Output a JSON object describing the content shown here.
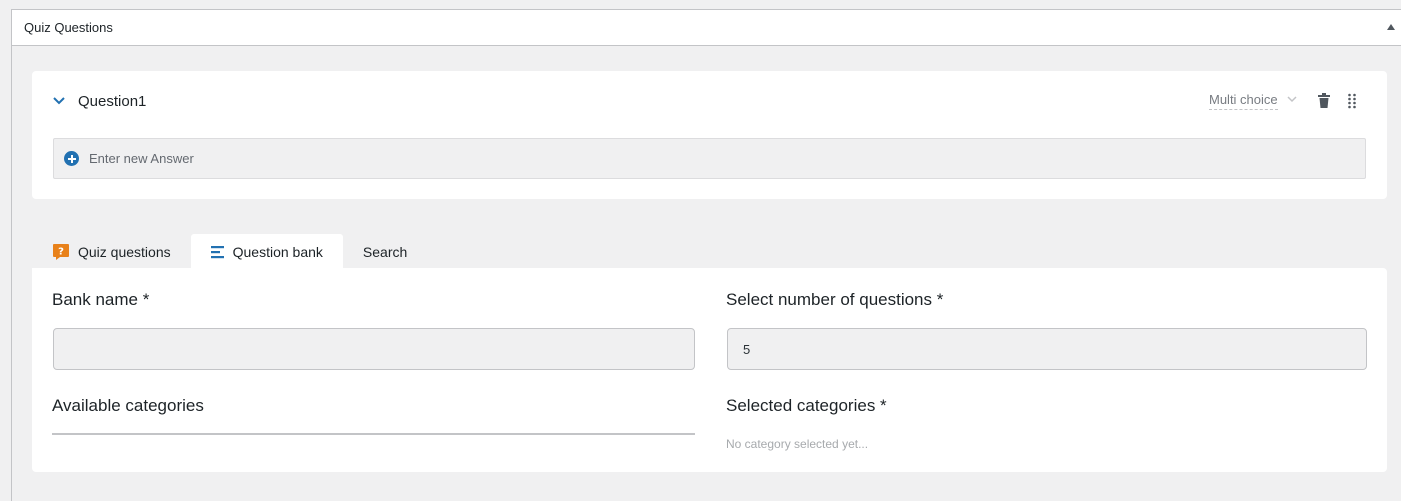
{
  "panel": {
    "title": "Quiz Questions"
  },
  "question": {
    "title": "Question1",
    "type": "Multi choice",
    "answer_placeholder": "Enter new Answer"
  },
  "tabs": [
    {
      "label": "Quiz questions",
      "icon": "question-badge-icon",
      "active": false
    },
    {
      "label": "Question bank",
      "icon": "list-lines-icon",
      "active": true
    },
    {
      "label": "Search",
      "active": false
    }
  ],
  "bank": {
    "bank_name_label": "Bank name *",
    "bank_name_value": "",
    "num_questions_label": "Select number of questions *",
    "num_questions_value": "5",
    "available_label": "Available categories",
    "selected_label": "Selected categories *",
    "empty_selected_note": "No category selected yet..."
  },
  "colors": {
    "accent": "#2271b1",
    "tab_icon_orange": "#e8811a",
    "panel_bg": "#f0f0f1"
  }
}
